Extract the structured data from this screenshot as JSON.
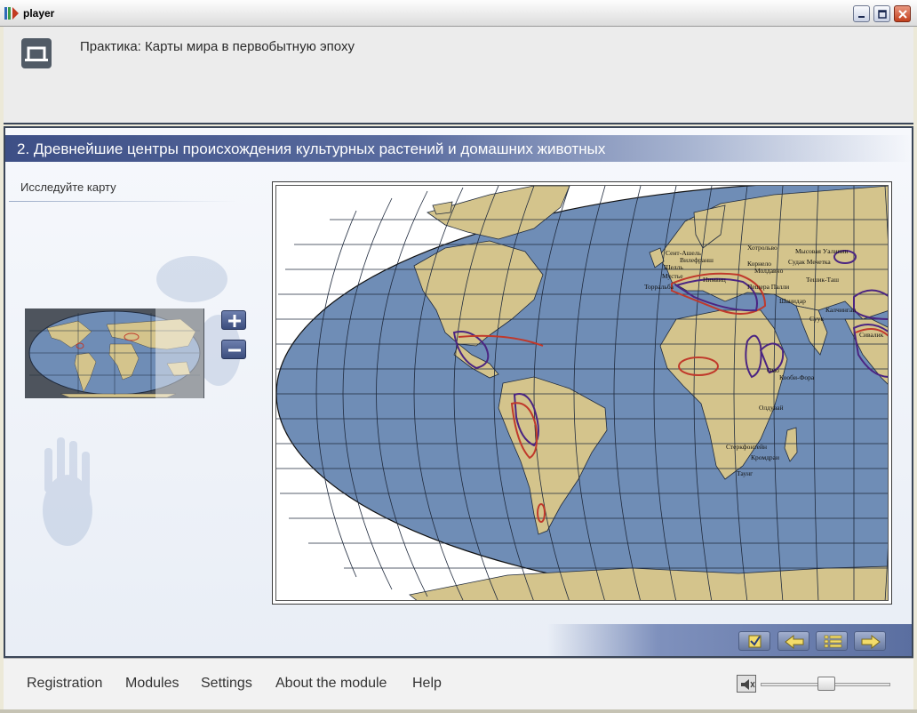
{
  "window": {
    "title": "player"
  },
  "header": {
    "breadcrumb": "Практика: Карты мира в первобытную эпоху"
  },
  "lesson": {
    "heading": "2. Древнейшие центры происхождения культурных растений и домашних животных",
    "subtitle": "Исследуйте карту"
  },
  "minimap": {
    "viewport_fraction_start": 0.73
  },
  "map": {
    "labels": [
      "Хотрольво",
      "Мысовая Уалипин",
      "Сент-Ашель",
      "Вилефранш",
      "Судак Мечетка",
      "Корнело",
      "Молдавно",
      "Тешик-Таш",
      "Шелль",
      "Мустье",
      "Нимвиц",
      "Торральба",
      "Пещера Палли",
      "Шанидар",
      "Калчингаи",
      "Суук",
      "Сивалик",
      "Омо",
      "Кооби-Фора",
      "Олдувай",
      "Стеркфонтейн",
      "Кромдраи",
      "Таунг"
    ],
    "region_colors": {
      "ocean": "#6f8db6",
      "land": "#d4c48c",
      "grid": "#1f2a3d",
      "crop_center": "#c0392b",
      "animal_center": "#4b2582"
    }
  },
  "footer": {
    "menu": [
      "Registration",
      "Modules",
      "Settings",
      "About the module",
      "Help"
    ],
    "volume": 0.5
  },
  "icons": [
    "app-logo-icon",
    "minimize-icon",
    "maximize-icon",
    "close-icon",
    "module-icon",
    "zoom-in-icon",
    "zoom-out-icon",
    "check-icon",
    "arrow-left-icon",
    "list-icon",
    "arrow-right-icon",
    "speaker-icon"
  ]
}
